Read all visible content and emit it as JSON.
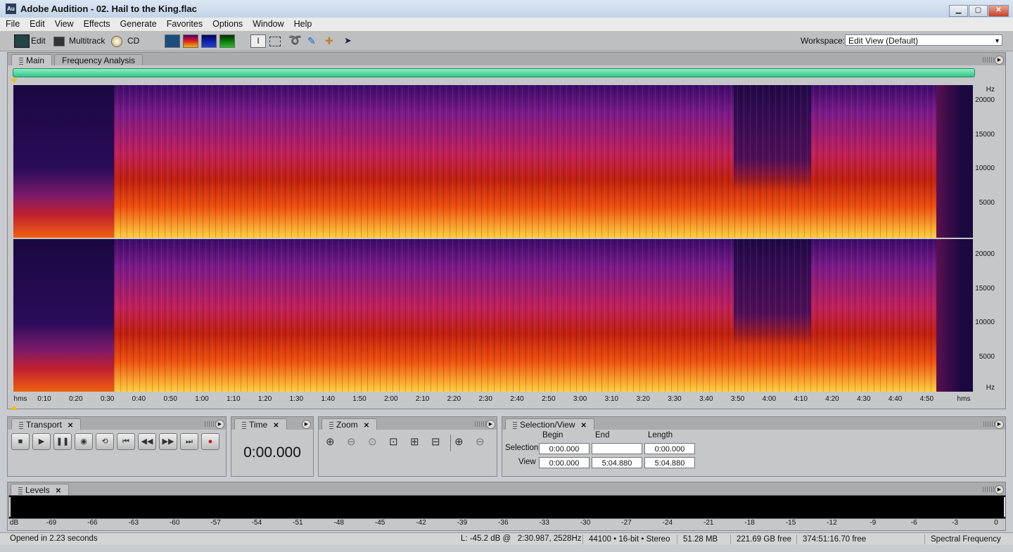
{
  "window": {
    "app_icon": "Au",
    "title": "Adobe Audition - 02. Hail to the King.flac",
    "controls": [
      "minimize-icon",
      "maximize-icon",
      "close-icon"
    ]
  },
  "menu": {
    "file": "File",
    "edit": "Edit",
    "view": "View",
    "effects": "Effects",
    "generate": "Generate",
    "favorites": "Favorites",
    "options": "Options",
    "window": "Window",
    "help": "Help"
  },
  "toolbar": {
    "edit_label": "Edit",
    "multitrack_label": "Multitrack",
    "cd_label": "CD",
    "workspace_label": "Workspace:",
    "workspace_value": "Edit View (Default)",
    "tools": [
      "time-selection-icon",
      "marquee-icon",
      "lasso-icon",
      "brush-icon",
      "spot-healing-icon",
      "scrub-icon"
    ]
  },
  "main_panel": {
    "tab_main": "Main",
    "tab_frequency": "Frequency Analysis"
  },
  "spectro": {
    "freq_unit": "Hz",
    "freq_labels": [
      "20000",
      "15000",
      "10000",
      "5000"
    ],
    "time_unit": "hms",
    "time_labels": [
      "0:10",
      "0:20",
      "0:30",
      "0:40",
      "0:50",
      "1:00",
      "1:10",
      "1:20",
      "1:30",
      "1:40",
      "1:50",
      "2:00",
      "2:10",
      "2:20",
      "2:30",
      "2:40",
      "2:50",
      "3:00",
      "3:10",
      "3:20",
      "3:30",
      "3:40",
      "3:50",
      "4:00",
      "4:10",
      "4:20",
      "4:30",
      "4:40",
      "4:50"
    ],
    "colors": {
      "low": "#1a0840",
      "mid": "#c02010",
      "high": "#ffd040"
    }
  },
  "transport": {
    "title": "Transport"
  },
  "time_panel": {
    "title": "Time",
    "value": "0:00.000"
  },
  "zoom_panel": {
    "title": "Zoom"
  },
  "selview": {
    "title": "Selection/View",
    "col_begin": "Begin",
    "col_end": "End",
    "col_length": "Length",
    "row_selection": "Selection",
    "row_view": "View",
    "sel_begin": "0:00.000",
    "sel_end": "",
    "sel_length": "0:00.000",
    "view_begin": "0:00.000",
    "view_end": "5:04.880",
    "view_length": "5:04.880"
  },
  "levels": {
    "title": "Levels",
    "unit": "dB",
    "scale": [
      "-69",
      "-66",
      "-63",
      "-60",
      "-57",
      "-54",
      "-51",
      "-48",
      "-45",
      "-42",
      "-39",
      "-36",
      "-33",
      "-30",
      "-27",
      "-24",
      "-21",
      "-18",
      "-15",
      "-12",
      "-9",
      "-6",
      "-3",
      "0"
    ]
  },
  "status": {
    "opened": "Opened in 2.23 seconds",
    "cursor": "L: -45.2 dB @   2:30.987, 2528Hz",
    "format": "44100 • 16-bit • Stereo",
    "size": "51.28 MB",
    "free": "221.69 GB free",
    "time_free": "374:51:16.70 free",
    "view_mode": "Spectral Frequency"
  }
}
